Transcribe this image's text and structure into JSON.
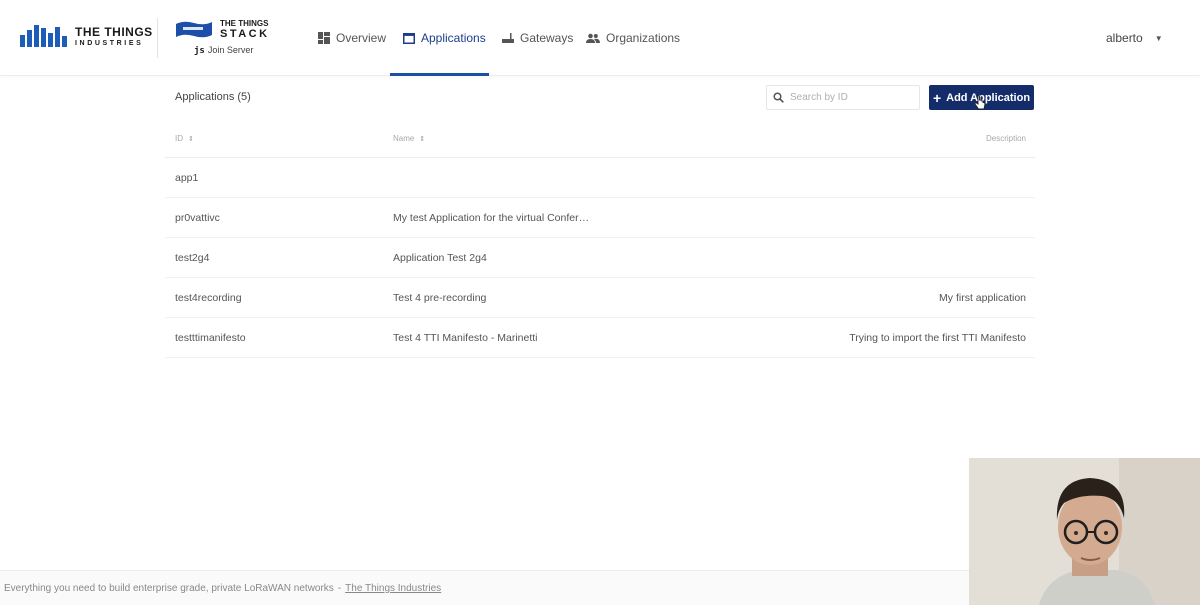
{
  "header": {
    "brand": {
      "line1": "THE THINGS",
      "line2": "INDUSTRIES"
    },
    "stack_logo": {
      "line1": "THE THINGS",
      "line2": "STACK",
      "js": "js",
      "subtitle": "Join Server"
    },
    "nav": [
      {
        "label": "Overview",
        "icon": "overview-icon"
      },
      {
        "label": "Applications",
        "icon": "application-icon",
        "active": true
      },
      {
        "label": "Gateways",
        "icon": "gateway-icon"
      },
      {
        "label": "Organizations",
        "icon": "organizations-icon"
      }
    ],
    "user": "alberto"
  },
  "applications": {
    "title": "Applications (5)",
    "search_placeholder": "Search by ID",
    "add_button": "Add Application",
    "columns": {
      "id": "ID",
      "name": "Name",
      "description": "Description"
    },
    "rows": [
      {
        "id": "app1",
        "name": "",
        "description": ""
      },
      {
        "id": "pr0vattivc",
        "name": "My test Application for the virtual Confer…",
        "description": ""
      },
      {
        "id": "test2g4",
        "name": "Application Test 2g4",
        "description": ""
      },
      {
        "id": "test4recording",
        "name": "Test 4 pre-recording",
        "description": "My first application"
      },
      {
        "id": "testttimanifesto",
        "name": "Test 4 TTI Manifesto - Marinetti",
        "description": "Trying to import the first TTI Manifesto"
      }
    ]
  },
  "footer": {
    "text": "Everything you need to build enterprise grade, private LoRaWAN networks",
    "separator": "-",
    "link": "The Things Industries"
  },
  "colors": {
    "primary": "#152c6a",
    "accent": "#1d4fa8",
    "logo_blue": "#1d5cb8"
  }
}
